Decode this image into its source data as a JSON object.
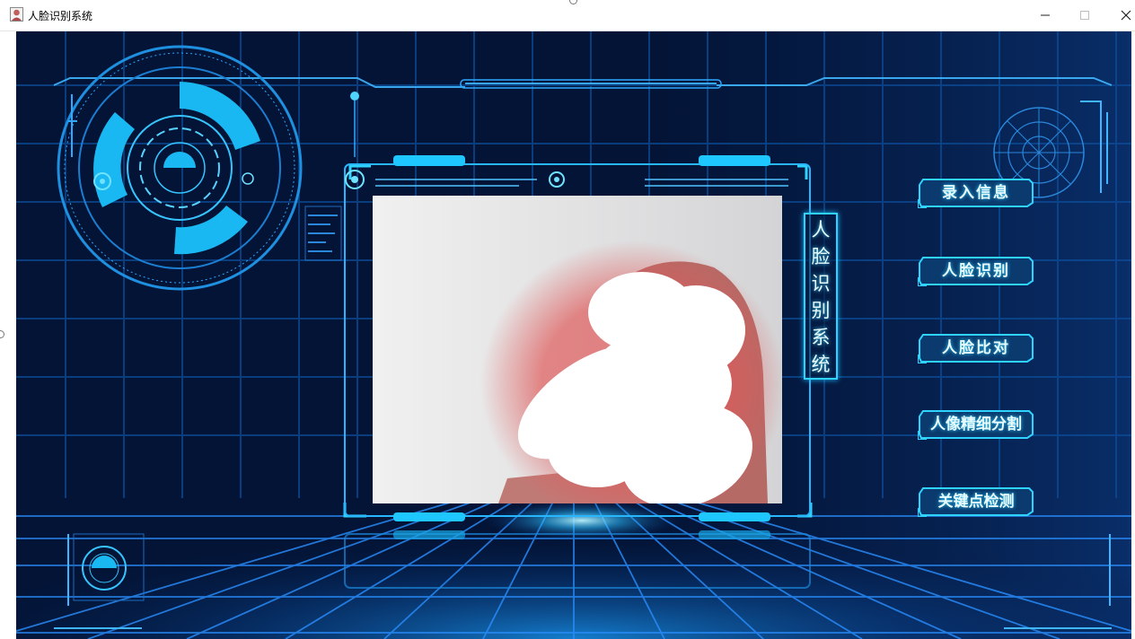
{
  "window": {
    "title": "人脸识别系统",
    "minimize_glyph": "─",
    "maximize_glyph": "□",
    "close_glyph": "✕"
  },
  "panel": {
    "title_chars": [
      "人",
      "脸",
      "识",
      "别",
      "系",
      "统"
    ]
  },
  "menu": [
    {
      "id": "enroll",
      "label": "录入信息"
    },
    {
      "id": "recognize",
      "label": "人脸识别"
    },
    {
      "id": "compare",
      "label": "人脸比对"
    },
    {
      "id": "segment",
      "label": "人像精细分割"
    },
    {
      "id": "keypoints",
      "label": "关键点检测"
    }
  ],
  "colors": {
    "accent": "#2ed3ff",
    "background": "#031436",
    "button_fill": "#0a3a6e"
  },
  "icons": {
    "app": "face-avatar-icon",
    "minimize": "minimize-icon",
    "maximize": "maximize-icon",
    "close": "close-icon"
  }
}
